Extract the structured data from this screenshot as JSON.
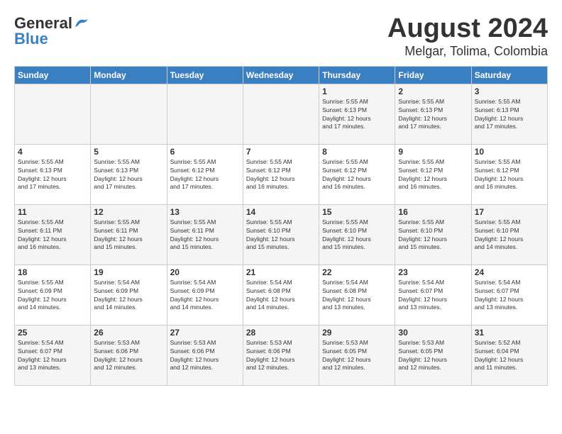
{
  "header": {
    "logo_general": "General",
    "logo_blue": "Blue",
    "month_year": "August 2024",
    "location": "Melgar, Tolima, Colombia"
  },
  "days_of_week": [
    "Sunday",
    "Monday",
    "Tuesday",
    "Wednesday",
    "Thursday",
    "Friday",
    "Saturday"
  ],
  "weeks": [
    {
      "days": [
        {
          "number": "",
          "info": ""
        },
        {
          "number": "",
          "info": ""
        },
        {
          "number": "",
          "info": ""
        },
        {
          "number": "",
          "info": ""
        },
        {
          "number": "1",
          "info": "Sunrise: 5:55 AM\nSunset: 6:13 PM\nDaylight: 12 hours\nand 17 minutes."
        },
        {
          "number": "2",
          "info": "Sunrise: 5:55 AM\nSunset: 6:13 PM\nDaylight: 12 hours\nand 17 minutes."
        },
        {
          "number": "3",
          "info": "Sunrise: 5:55 AM\nSunset: 6:13 PM\nDaylight: 12 hours\nand 17 minutes."
        }
      ]
    },
    {
      "days": [
        {
          "number": "4",
          "info": "Sunrise: 5:55 AM\nSunset: 6:13 PM\nDaylight: 12 hours\nand 17 minutes."
        },
        {
          "number": "5",
          "info": "Sunrise: 5:55 AM\nSunset: 6:13 PM\nDaylight: 12 hours\nand 17 minutes."
        },
        {
          "number": "6",
          "info": "Sunrise: 5:55 AM\nSunset: 6:12 PM\nDaylight: 12 hours\nand 17 minutes."
        },
        {
          "number": "7",
          "info": "Sunrise: 5:55 AM\nSunset: 6:12 PM\nDaylight: 12 hours\nand 16 minutes."
        },
        {
          "number": "8",
          "info": "Sunrise: 5:55 AM\nSunset: 6:12 PM\nDaylight: 12 hours\nand 16 minutes."
        },
        {
          "number": "9",
          "info": "Sunrise: 5:55 AM\nSunset: 6:12 PM\nDaylight: 12 hours\nand 16 minutes."
        },
        {
          "number": "10",
          "info": "Sunrise: 5:55 AM\nSunset: 6:12 PM\nDaylight: 12 hours\nand 16 minutes."
        }
      ]
    },
    {
      "days": [
        {
          "number": "11",
          "info": "Sunrise: 5:55 AM\nSunset: 6:11 PM\nDaylight: 12 hours\nand 16 minutes."
        },
        {
          "number": "12",
          "info": "Sunrise: 5:55 AM\nSunset: 6:11 PM\nDaylight: 12 hours\nand 15 minutes."
        },
        {
          "number": "13",
          "info": "Sunrise: 5:55 AM\nSunset: 6:11 PM\nDaylight: 12 hours\nand 15 minutes."
        },
        {
          "number": "14",
          "info": "Sunrise: 5:55 AM\nSunset: 6:10 PM\nDaylight: 12 hours\nand 15 minutes."
        },
        {
          "number": "15",
          "info": "Sunrise: 5:55 AM\nSunset: 6:10 PM\nDaylight: 12 hours\nand 15 minutes."
        },
        {
          "number": "16",
          "info": "Sunrise: 5:55 AM\nSunset: 6:10 PM\nDaylight: 12 hours\nand 15 minutes."
        },
        {
          "number": "17",
          "info": "Sunrise: 5:55 AM\nSunset: 6:10 PM\nDaylight: 12 hours\nand 14 minutes."
        }
      ]
    },
    {
      "days": [
        {
          "number": "18",
          "info": "Sunrise: 5:55 AM\nSunset: 6:09 PM\nDaylight: 12 hours\nand 14 minutes."
        },
        {
          "number": "19",
          "info": "Sunrise: 5:54 AM\nSunset: 6:09 PM\nDaylight: 12 hours\nand 14 minutes."
        },
        {
          "number": "20",
          "info": "Sunrise: 5:54 AM\nSunset: 6:09 PM\nDaylight: 12 hours\nand 14 minutes."
        },
        {
          "number": "21",
          "info": "Sunrise: 5:54 AM\nSunset: 6:08 PM\nDaylight: 12 hours\nand 14 minutes."
        },
        {
          "number": "22",
          "info": "Sunrise: 5:54 AM\nSunset: 6:08 PM\nDaylight: 12 hours\nand 13 minutes."
        },
        {
          "number": "23",
          "info": "Sunrise: 5:54 AM\nSunset: 6:07 PM\nDaylight: 12 hours\nand 13 minutes."
        },
        {
          "number": "24",
          "info": "Sunrise: 5:54 AM\nSunset: 6:07 PM\nDaylight: 12 hours\nand 13 minutes."
        }
      ]
    },
    {
      "days": [
        {
          "number": "25",
          "info": "Sunrise: 5:54 AM\nSunset: 6:07 PM\nDaylight: 12 hours\nand 13 minutes."
        },
        {
          "number": "26",
          "info": "Sunrise: 5:53 AM\nSunset: 6:06 PM\nDaylight: 12 hours\nand 12 minutes."
        },
        {
          "number": "27",
          "info": "Sunrise: 5:53 AM\nSunset: 6:06 PM\nDaylight: 12 hours\nand 12 minutes."
        },
        {
          "number": "28",
          "info": "Sunrise: 5:53 AM\nSunset: 6:06 PM\nDaylight: 12 hours\nand 12 minutes."
        },
        {
          "number": "29",
          "info": "Sunrise: 5:53 AM\nSunset: 6:05 PM\nDaylight: 12 hours\nand 12 minutes."
        },
        {
          "number": "30",
          "info": "Sunrise: 5:53 AM\nSunset: 6:05 PM\nDaylight: 12 hours\nand 12 minutes."
        },
        {
          "number": "31",
          "info": "Sunrise: 5:52 AM\nSunset: 6:04 PM\nDaylight: 12 hours\nand 11 minutes."
        }
      ]
    }
  ]
}
